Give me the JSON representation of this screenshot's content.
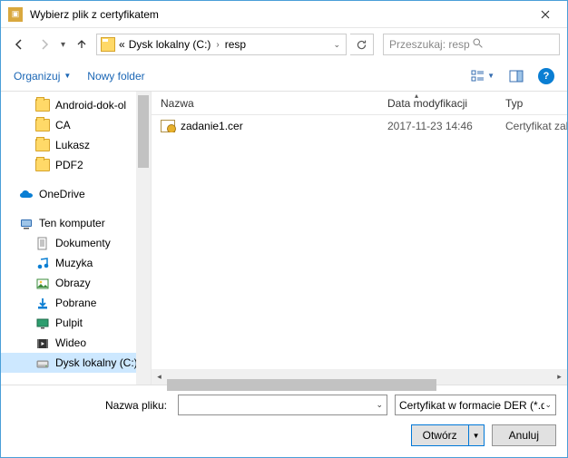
{
  "title": "Wybierz plik z certyfikatem",
  "address": {
    "prefix": "«",
    "drive": "Dysk lokalny (C:)",
    "folder": "resp"
  },
  "search": {
    "placeholder": "Przeszukaj: resp"
  },
  "toolbar": {
    "organize": "Organizuj",
    "newfolder": "Nowy folder"
  },
  "columns": {
    "name": "Nazwa",
    "date": "Data modyfikacji",
    "type": "Typ"
  },
  "tree": [
    {
      "label": "Android-dok-ol",
      "icon": "folder",
      "depth": 1
    },
    {
      "label": "CA",
      "icon": "folder",
      "depth": 1
    },
    {
      "label": "Lukasz",
      "icon": "folder",
      "depth": 1
    },
    {
      "label": "PDF2",
      "icon": "folder",
      "depth": 1
    },
    {
      "label": "OneDrive",
      "icon": "onedrive",
      "depth": 0
    },
    {
      "label": "Ten komputer",
      "icon": "pc",
      "depth": 0
    },
    {
      "label": "Dokumenty",
      "icon": "doc",
      "depth": 1
    },
    {
      "label": "Muzyka",
      "icon": "mus",
      "depth": 1
    },
    {
      "label": "Obrazy",
      "icon": "img",
      "depth": 1
    },
    {
      "label": "Pobrane",
      "icon": "dl",
      "depth": 1
    },
    {
      "label": "Pulpit",
      "icon": "desk",
      "depth": 1
    },
    {
      "label": "Wideo",
      "icon": "vid",
      "depth": 1
    },
    {
      "label": "Dysk lokalny (C:)",
      "icon": "drive",
      "depth": 1,
      "selected": true
    }
  ],
  "files": [
    {
      "name": "zadanie1.cer",
      "date": "2017-11-23 14:46",
      "type": "Certyfikat zab"
    }
  ],
  "bottom": {
    "filename_label": "Nazwa pliku:",
    "filename_value": "",
    "filter": "Certyfikat w formacie DER (*.de",
    "open": "Otwórz",
    "cancel": "Anuluj"
  }
}
